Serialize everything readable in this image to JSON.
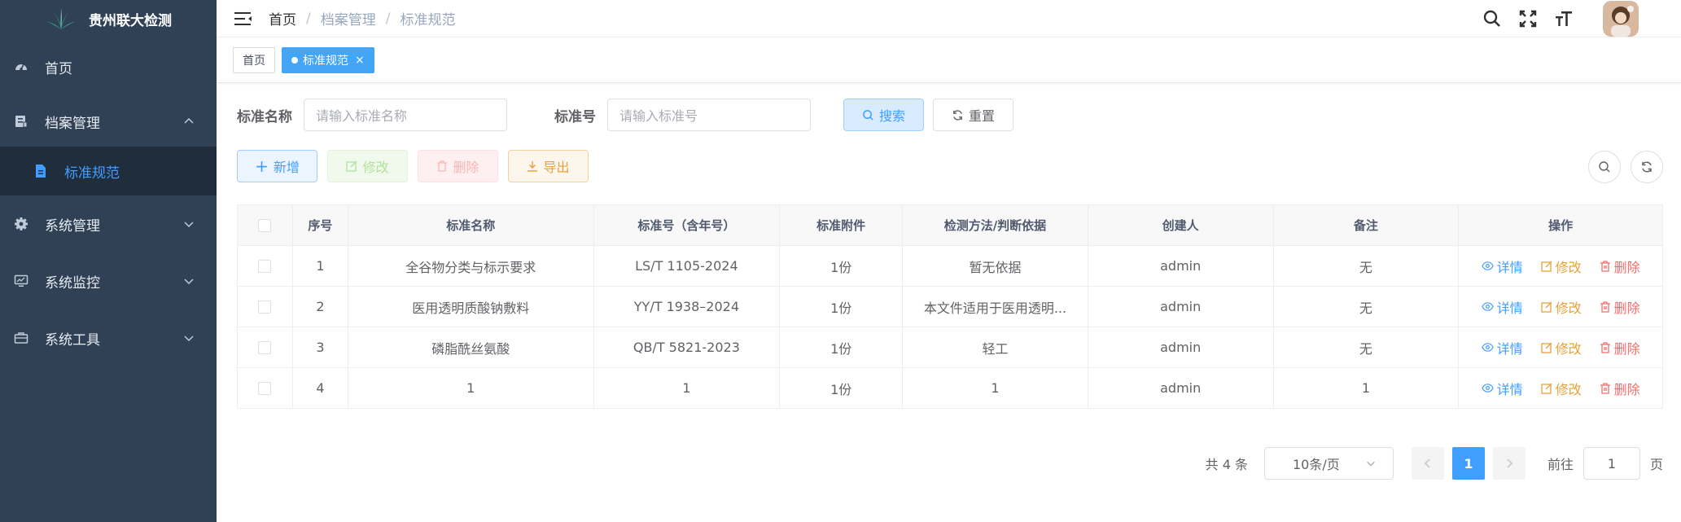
{
  "brand": {
    "title": "贵州联大检测",
    "accent": "#409eff",
    "sidebar_bg": "#304156"
  },
  "sidebar": {
    "items": [
      {
        "label": "首页",
        "icon": "dashboard-icon"
      },
      {
        "label": "档案管理",
        "icon": "archive-icon",
        "expanded": true,
        "children": [
          {
            "label": "标准规范",
            "icon": "document-icon",
            "active": true
          }
        ]
      },
      {
        "label": "系统管理",
        "icon": "gear-icon"
      },
      {
        "label": "系统监控",
        "icon": "monitor-icon"
      },
      {
        "label": "系统工具",
        "icon": "toolbox-icon"
      }
    ]
  },
  "breadcrumb": [
    "首页",
    "档案管理",
    "标准规范"
  ],
  "tags": [
    {
      "label": "首页",
      "active": false
    },
    {
      "label": "标准规范",
      "active": true
    }
  ],
  "search": {
    "name_label": "标准名称",
    "name_placeholder": "请输入标准名称",
    "no_label": "标准号",
    "no_placeholder": "请输入标准号",
    "search_btn": "搜索",
    "reset_btn": "重置"
  },
  "toolbar": {
    "add": "新增",
    "edit": "修改",
    "delete": "删除",
    "export": "导出"
  },
  "table": {
    "headers": [
      "序号",
      "标准名称",
      "标准号（含年号）",
      "标准附件",
      "检测方法/判断依据",
      "创建人",
      "备注",
      "操作"
    ],
    "rows": [
      {
        "no": "1",
        "name": "全谷物分类与标示要求",
        "code": "LS/T 1105-2024",
        "attach": "1份",
        "method": "暂无依据",
        "creator": "admin",
        "remark": "无"
      },
      {
        "no": "2",
        "name": "医用透明质酸钠敷料",
        "code": "YY/T 1938–2024",
        "attach": "1份",
        "method": "本文件适用于医用透明...",
        "creator": "admin",
        "remark": "无"
      },
      {
        "no": "3",
        "name": "磷脂酰丝氨酸",
        "code": "QB/T 5821-2023",
        "attach": "1份",
        "method": "轻工",
        "creator": "admin",
        "remark": "无"
      },
      {
        "no": "4",
        "name": "1",
        "code": "1",
        "attach": "1份",
        "method": "1",
        "creator": "admin",
        "remark": "1"
      }
    ],
    "ops": {
      "view": "详情",
      "edit": "修改",
      "delete": "删除"
    }
  },
  "pager": {
    "total": "共 4 条",
    "size": "10条/页",
    "current": "1",
    "goto_label": "前往",
    "goto_value": "1",
    "page_unit": "页"
  }
}
